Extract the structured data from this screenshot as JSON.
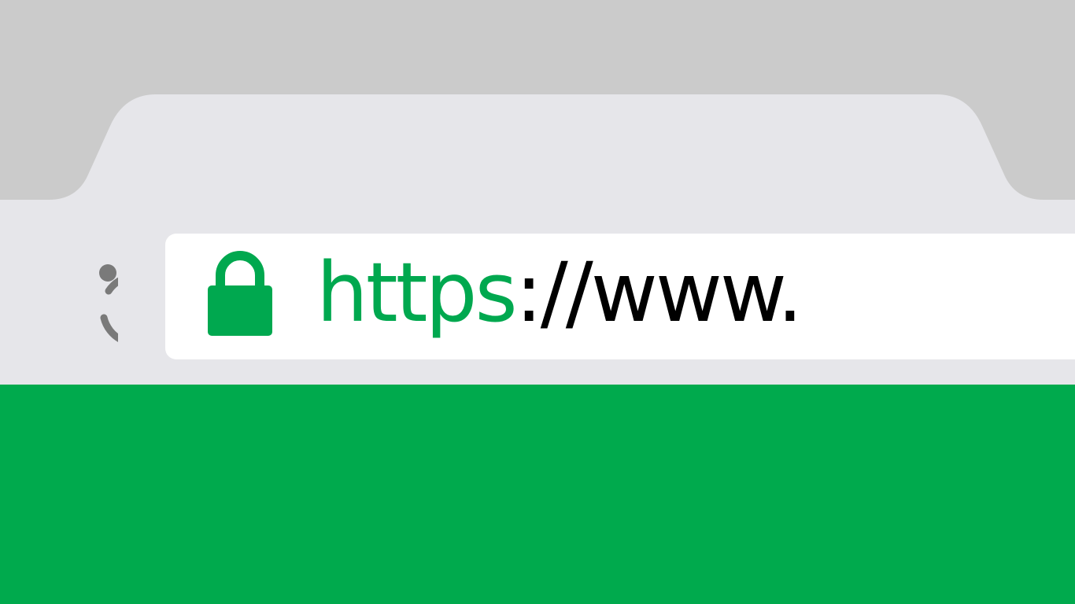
{
  "address_bar": {
    "url_scheme": "https",
    "url_rest": "://www.",
    "secure": true
  },
  "icons": {
    "reload": "reload-icon",
    "lock": "lock-icon"
  },
  "colors": {
    "background": "#cbcbcb",
    "tab": "#e6e6ea",
    "address_bar": "#ffffff",
    "secure_green": "#00a84f",
    "url_text": "#000000",
    "content": "#00aa4d",
    "icon_gray": "#7a7a7a"
  }
}
